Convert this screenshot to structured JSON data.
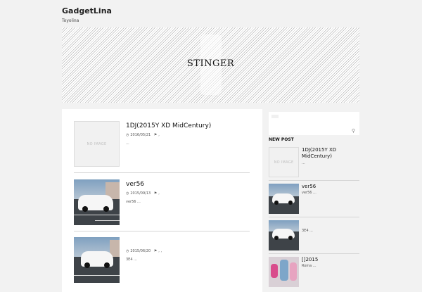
{
  "site": {
    "title": "GadgetLina",
    "description": "Toyolina"
  },
  "header": {
    "banner_text": "STINGER"
  },
  "posts": [
    {
      "title": "1DJ(2015Y XD MidCentury)",
      "date": "2016/05/21",
      "tags": ",",
      "excerpt": "...",
      "thumb": "NO IMAGE"
    },
    {
      "title": "ver56",
      "date": "2015/09/13",
      "tags": ",",
      "excerpt": "ver56 ...",
      "thumb": "photo"
    },
    {
      "title": "",
      "date": "2015/06/20",
      "tags": ", ,",
      "excerpt": "3E4 ...",
      "thumb": "photo"
    }
  ],
  "sidebar": {
    "heading": "NEW POST",
    "items": [
      {
        "title": "1DJ(2015Y XD MidCentury)",
        "excerpt": "...",
        "thumb": "NO IMAGE"
      },
      {
        "title": "ver56",
        "excerpt": "ver56 ...",
        "thumb": "photo"
      },
      {
        "title": "",
        "excerpt": "3E4 ...",
        "thumb": "photo"
      },
      {
        "title": "[]2015",
        "excerpt": "Roma ...",
        "thumb": "photo"
      }
    ]
  },
  "icons": {
    "clock": "clock-icon",
    "tag": "tag-icon",
    "search": "search-icon"
  }
}
